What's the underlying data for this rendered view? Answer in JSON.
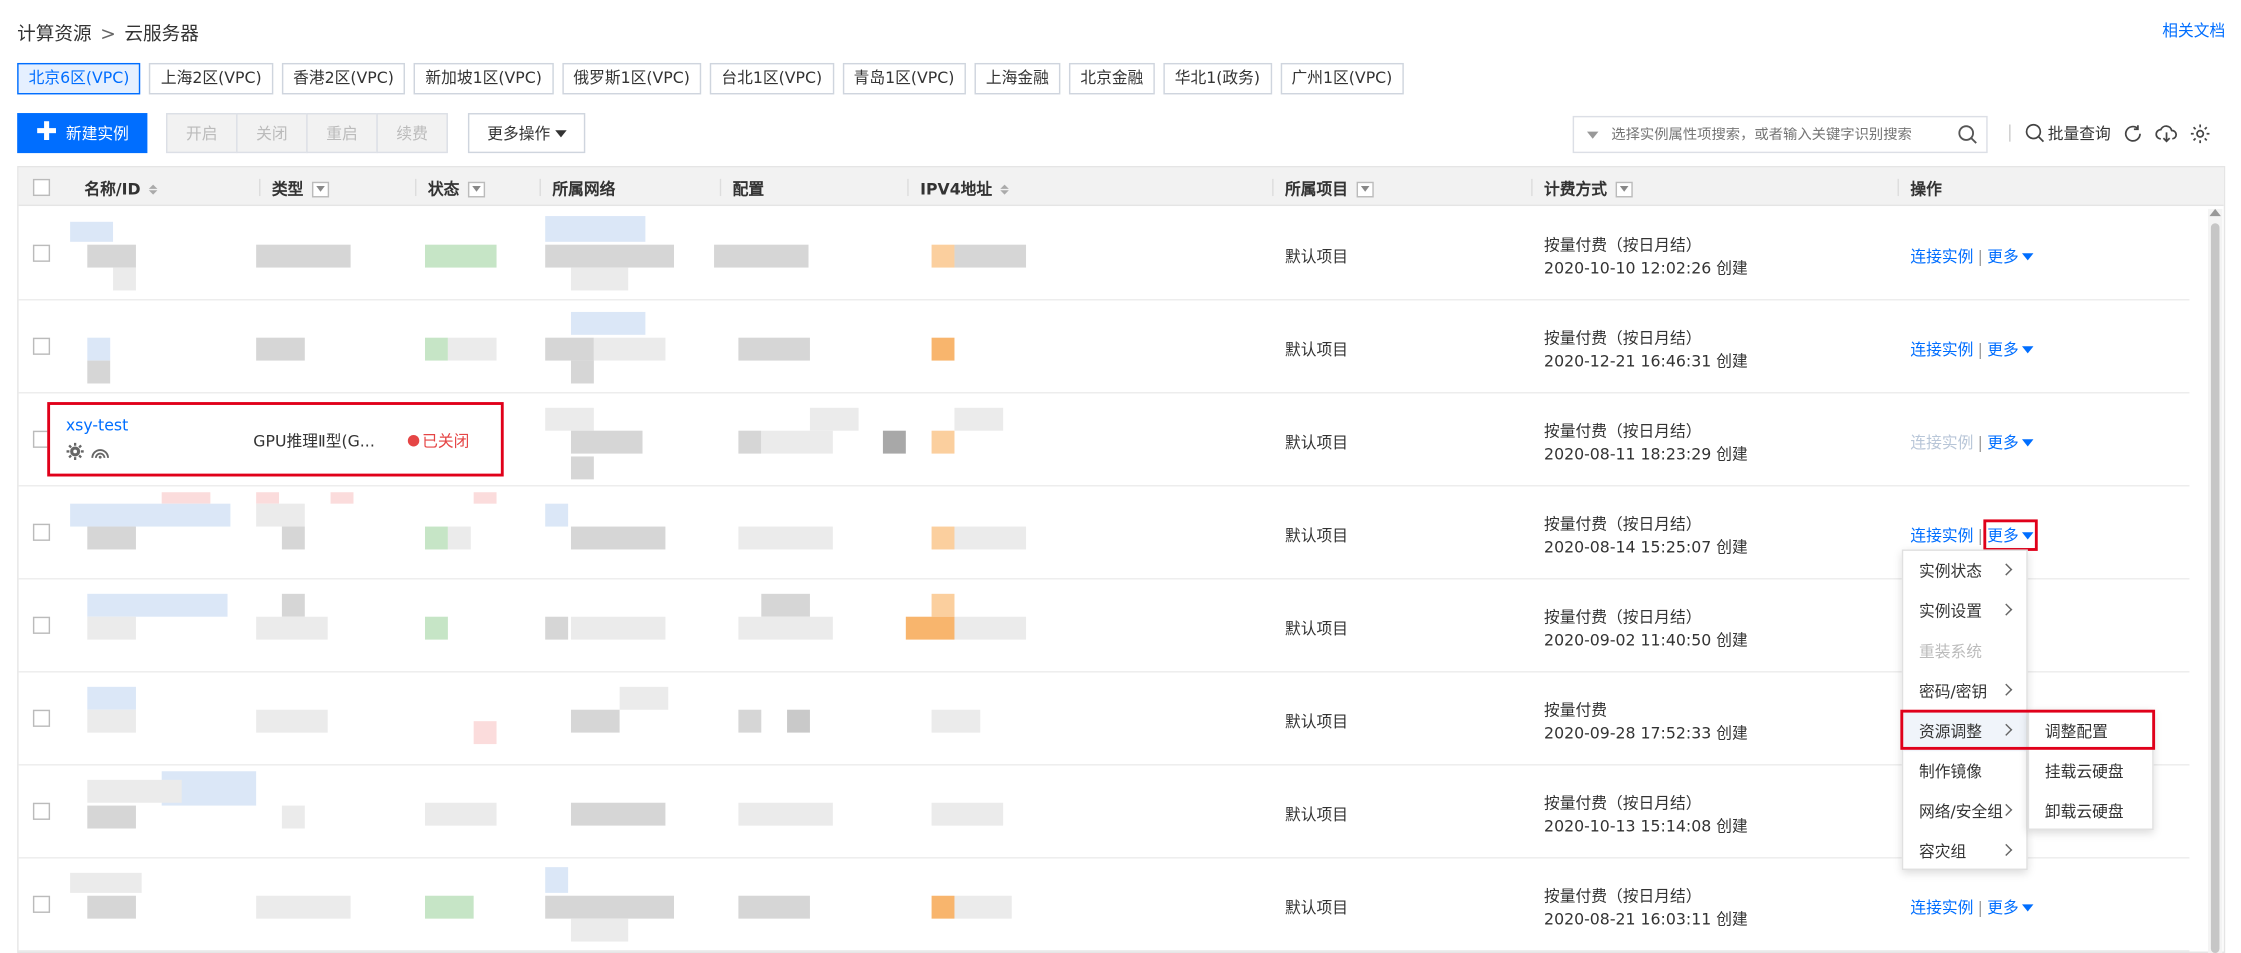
{
  "breadcrumb": {
    "parent": "计算资源",
    "separator": ">",
    "current": "云服务器"
  },
  "doc_link": "相关文档",
  "regions": [
    "北京6区(VPC)",
    "上海2区(VPC)",
    "香港2区(VPC)",
    "新加坡1区(VPC)",
    "俄罗斯1区(VPC)",
    "台北1区(VPC)",
    "青岛1区(VPC)",
    "上海金融",
    "北京金融",
    "华北1(政务)",
    "广州1区(VPC)"
  ],
  "active_region": "北京6区(VPC)",
  "toolbar": {
    "new_instance": "新建实例",
    "start": "开启",
    "stop": "关闭",
    "restart": "重启",
    "renew": "续费",
    "more_ops": "更多操作"
  },
  "search": {
    "placeholder": "选择实例属性项搜索，或者输入关键字识别搜索"
  },
  "tools": {
    "batch_query": "批量查询"
  },
  "columns": {
    "name_id": "名称/ID",
    "type": "类型",
    "status": "状态",
    "network": "所属网络",
    "config": "配置",
    "ipv4": "IPV4地址",
    "project": "所属项目",
    "billing": "计费方式",
    "ops": "操作"
  },
  "rows": [
    {
      "project": "默认项目",
      "billing": "按量付费（按日月结）",
      "created": "2020-10-10 12:02:26 创建",
      "connect": "连接实例",
      "more": "更多"
    },
    {
      "project": "默认项目",
      "billing": "按量付费（按日月结）",
      "created": "2020-12-21 16:46:31 创建",
      "connect": "连接实例",
      "more": "更多"
    },
    {
      "project": "默认项目",
      "billing": "按量付费（按日月结）",
      "created": "2020-08-11 18:23:29 创建",
      "connect": "连接实例",
      "more": "更多"
    },
    {
      "project": "默认项目",
      "billing": "按量付费（按日月结）",
      "created": "2020-08-14 15:25:07 创建",
      "connect": "连接实例",
      "more": "更多"
    },
    {
      "project": "默认项目",
      "billing": "按量付费（按日月结）",
      "created": "2020-09-02 11:40:50 创建",
      "connect": "",
      "more": ""
    },
    {
      "project": "默认项目",
      "billing": "按量付费",
      "created": "2020-09-28 17:52:33 创建",
      "connect": "",
      "more": ""
    },
    {
      "project": "默认项目",
      "billing": "按量付费（按日月结）",
      "created": "2020-10-13 15:14:08 创建",
      "connect": "",
      "more": ""
    },
    {
      "project": "默认项目",
      "billing": "按量付费（按日月结）",
      "created": "2020-08-21 16:03:11 创建",
      "connect": "连接实例",
      "more": "更多"
    }
  ],
  "highlight_instance": {
    "name": "xsy-test",
    "type": "GPU推理Ⅱ型(G...",
    "status": "已关闭",
    "status_color": "#e54545"
  },
  "more_menu": [
    {
      "label": "实例状态",
      "submenu": true,
      "disabled": false
    },
    {
      "label": "实例设置",
      "submenu": true,
      "disabled": false
    },
    {
      "label": "重装系统",
      "submenu": false,
      "disabled": true
    },
    {
      "label": "密码/密钥",
      "submenu": true,
      "disabled": false
    },
    {
      "label": "资源调整",
      "submenu": true,
      "disabled": false,
      "active": true
    },
    {
      "label": "制作镜像",
      "submenu": false,
      "disabled": false
    },
    {
      "label": "网络/安全组",
      "submenu": true,
      "disabled": false
    },
    {
      "label": "容灾组",
      "submenu": true,
      "disabled": false
    }
  ],
  "resource_submenu": [
    "调整配置",
    "挂载云硬盘",
    "卸载云硬盘"
  ],
  "colors": {
    "accent": "#006eff",
    "highlight_border": "#e0001a",
    "status_closed": "#e54545"
  },
  "icons": [
    "plus-icon",
    "search-icon",
    "refresh-icon",
    "download-icon",
    "gear-icon",
    "settings-icon",
    "dashboard-icon",
    "chevron-right-icon",
    "caret-down-icon"
  ]
}
